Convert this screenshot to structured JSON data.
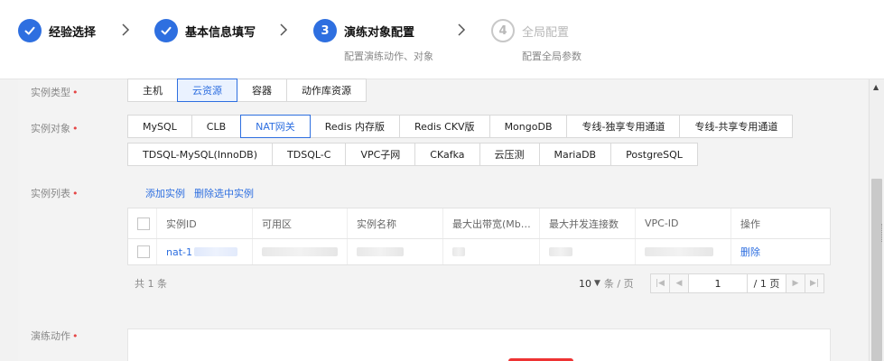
{
  "steps": [
    {
      "label": "经验选择",
      "status": "done"
    },
    {
      "label": "基本信息填写",
      "status": "done"
    },
    {
      "number": "3",
      "label": "演练对象配置",
      "sub": "配置演练动作、对象",
      "status": "active"
    },
    {
      "number": "4",
      "label": "全局配置",
      "sub": "配置全局参数",
      "status": "todo"
    }
  ],
  "instance_type": {
    "label": "实例类型",
    "options": [
      "主机",
      "云资源",
      "容器",
      "动作库资源"
    ],
    "selected": "云资源"
  },
  "instance_object": {
    "label": "实例对象",
    "row1": [
      "MySQL",
      "CLB",
      "NAT网关",
      "Redis 内存版",
      "Redis CKV版",
      "MongoDB",
      "专线-独享专用通道",
      "专线-共享专用通道"
    ],
    "row2": [
      "TDSQL-MySQL(InnoDB)",
      "TDSQL-C",
      "VPC子网",
      "CKafka",
      "云压测",
      "MariaDB",
      "PostgreSQL"
    ],
    "selected": "NAT网关"
  },
  "instance_list": {
    "label": "实例列表",
    "add_link": "添加实例",
    "delete_link": "删除选中实例",
    "columns": [
      "实例ID",
      "可用区",
      "实例名称",
      "最大出带宽(Mb…",
      "最大并发连接数",
      "VPC-ID",
      "操作"
    ],
    "rows": [
      {
        "id_prefix": "nat-1",
        "action": "删除"
      }
    ]
  },
  "pager": {
    "total": "共 1 条",
    "page_size": "10",
    "page_size_unit": "条 / 页",
    "current_page": "1",
    "total_pages": "/ 1 页"
  },
  "drill_action": {
    "label": "演练动作"
  },
  "colors": {
    "primary": "#2e6fe0",
    "required": "#e54545",
    "danger_button": "#ee3333"
  }
}
